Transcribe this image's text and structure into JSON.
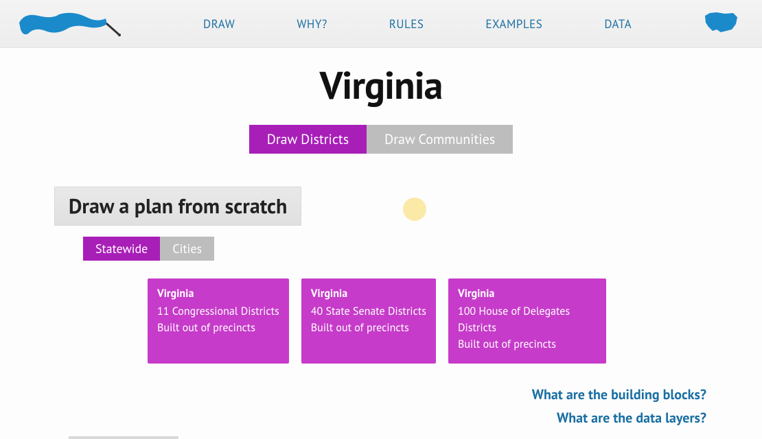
{
  "nav": {
    "items": [
      {
        "label": "DRAW"
      },
      {
        "label": "WHY?"
      },
      {
        "label": "RULES"
      },
      {
        "label": "EXAMPLES"
      },
      {
        "label": "DATA"
      }
    ]
  },
  "page": {
    "title": "Virginia"
  },
  "modeTabs": {
    "draw_districts": "Draw Districts",
    "draw_communities": "Draw Communities"
  },
  "section": {
    "scratch_heading": "Draw a plan from scratch"
  },
  "scopeTabs": {
    "statewide": "Statewide",
    "cities": "Cities"
  },
  "cards": [
    {
      "state": "Virginia",
      "line1": "11 Congressional Districts",
      "line2": "Built out of precincts"
    },
    {
      "state": "Virginia",
      "line1": "40 State Senate Districts",
      "line2": "Built out of precincts"
    },
    {
      "state": "Virginia",
      "line1": "100 House of Delegates Districts",
      "line2": "Built out of precincts"
    }
  ],
  "infoLinks": {
    "building_blocks": "What are the building blocks?",
    "data_layers": "What are the data layers?"
  }
}
